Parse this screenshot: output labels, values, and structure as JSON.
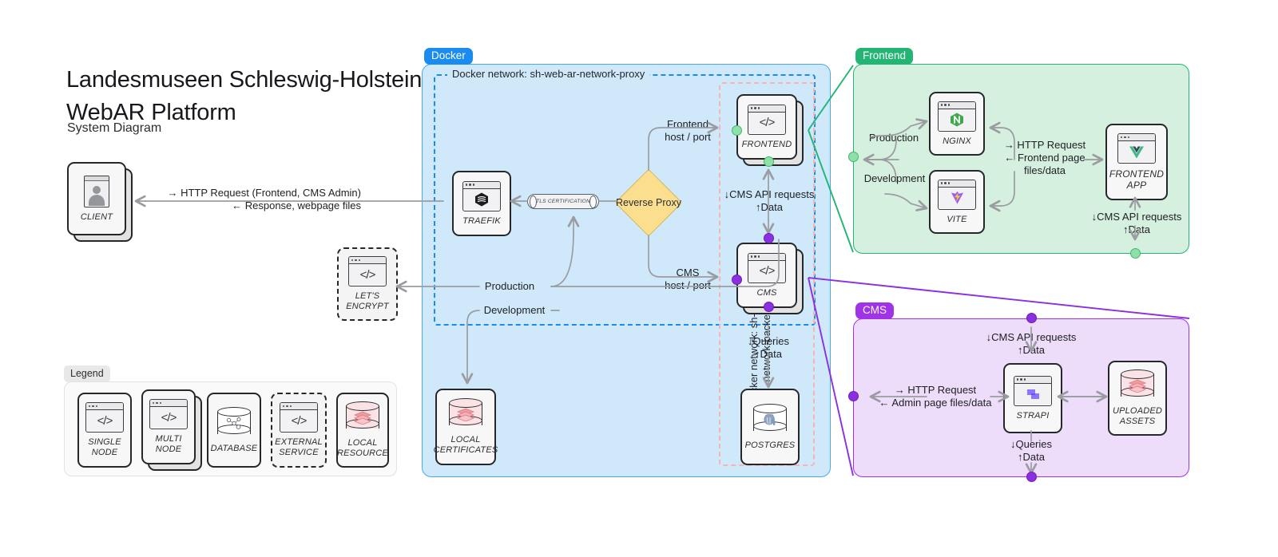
{
  "title": {
    "line1": "Landesmuseen Schleswig-Holstein",
    "line2": "WebAR Platform",
    "subtitle": "System Diagram"
  },
  "groups": {
    "docker": {
      "label": "Docker",
      "color": "#1a8cf0",
      "fill": "#cfe9fb"
    },
    "frontend": {
      "label": "Frontend",
      "color": "#22b573",
      "fill": "#d6f0e0"
    },
    "cms": {
      "label": "CMS",
      "color": "#a033e8",
      "fill": "#eddcfa"
    }
  },
  "networks": {
    "proxy": "Docker network: sh-web-ar-network-proxy",
    "backend": "Docker network:\nsh-web-ar-network-backend"
  },
  "nodes": {
    "client": {
      "label": "CLIENT",
      "icon": "avatar-icon",
      "type": "multi-node"
    },
    "traefik": {
      "label": "TRAEFIK",
      "icon": "traefik-icon",
      "type": "single-node"
    },
    "lets_encrypt": {
      "label": "LET'S\nENCRYPT",
      "icon": "code-window-icon",
      "type": "external-service"
    },
    "reverse_proxy": {
      "label": "Reverse\nProxy",
      "shape": "diamond"
    },
    "tls": {
      "label": "TLS CERTIFICATION",
      "shape": "cylinder"
    },
    "frontend": {
      "label": "FRONTEND",
      "icon": "code-window-icon",
      "type": "multi-node"
    },
    "cms": {
      "label": "CMS",
      "icon": "code-window-icon",
      "type": "multi-node"
    },
    "local_certificates": {
      "label": "LOCAL\nCERTIFICATES",
      "icon": "local-resource-icon",
      "type": "single-node"
    },
    "postgres": {
      "label": "POSTGRES",
      "icon": "postgres-icon",
      "type": "database"
    },
    "nginx": {
      "label": "NGINX",
      "icon": "nginx-icon",
      "type": "single-node"
    },
    "vite": {
      "label": "VITE",
      "icon": "vite-icon",
      "type": "single-node"
    },
    "frontend_app": {
      "label": "FRONTEND\nAPP",
      "icon": "vue-icon",
      "type": "single-node"
    },
    "strapi": {
      "label": "STRAPI",
      "icon": "strapi-icon",
      "type": "single-node"
    },
    "uploaded_assets": {
      "label": "UPLOADED\nASSETS",
      "icon": "local-resource-icon",
      "type": "local-resource"
    }
  },
  "edges": {
    "client_traefik": "→ HTTP Request (Frontend, CMS Admin)\n← Response, webpage files",
    "frontend_hostport": "Frontend\nhost / port",
    "cms_hostport": "CMS\nhost / port",
    "production_docker": "Production",
    "development_docker": "Development",
    "cms_api_docker": "↓CMS API requests\n↑Data",
    "queries_docker": "↓Queries\n↑Data",
    "production_frontend": "Production",
    "development_frontend": "Development",
    "http_frontend": "→ HTTP Request\n← Frontend page\nfiles/data",
    "cms_api_frontend": "↓CMS API requests\n↑Data",
    "cms_api_cms": "↓CMS API requests\n↑Data",
    "http_cms": "→ HTTP Request\n← Admin page files/data",
    "queries_cms": "↓Queries\n↑Data"
  },
  "legend": {
    "label": "Legend",
    "items": [
      {
        "label": "SINGLE\nNODE",
        "icon": "code-window-icon",
        "type": "single-node"
      },
      {
        "label": "MULTI\nNODE",
        "icon": "code-window-icon",
        "type": "multi-node"
      },
      {
        "label": "DATABASE",
        "icon": "database-icon",
        "type": "database"
      },
      {
        "label": "EXTERNAL\nSERVICE",
        "icon": "code-window-icon",
        "type": "external-service"
      },
      {
        "label": "LOCAL\nRESOURCE",
        "icon": "local-resource-icon",
        "type": "local-resource"
      }
    ]
  }
}
